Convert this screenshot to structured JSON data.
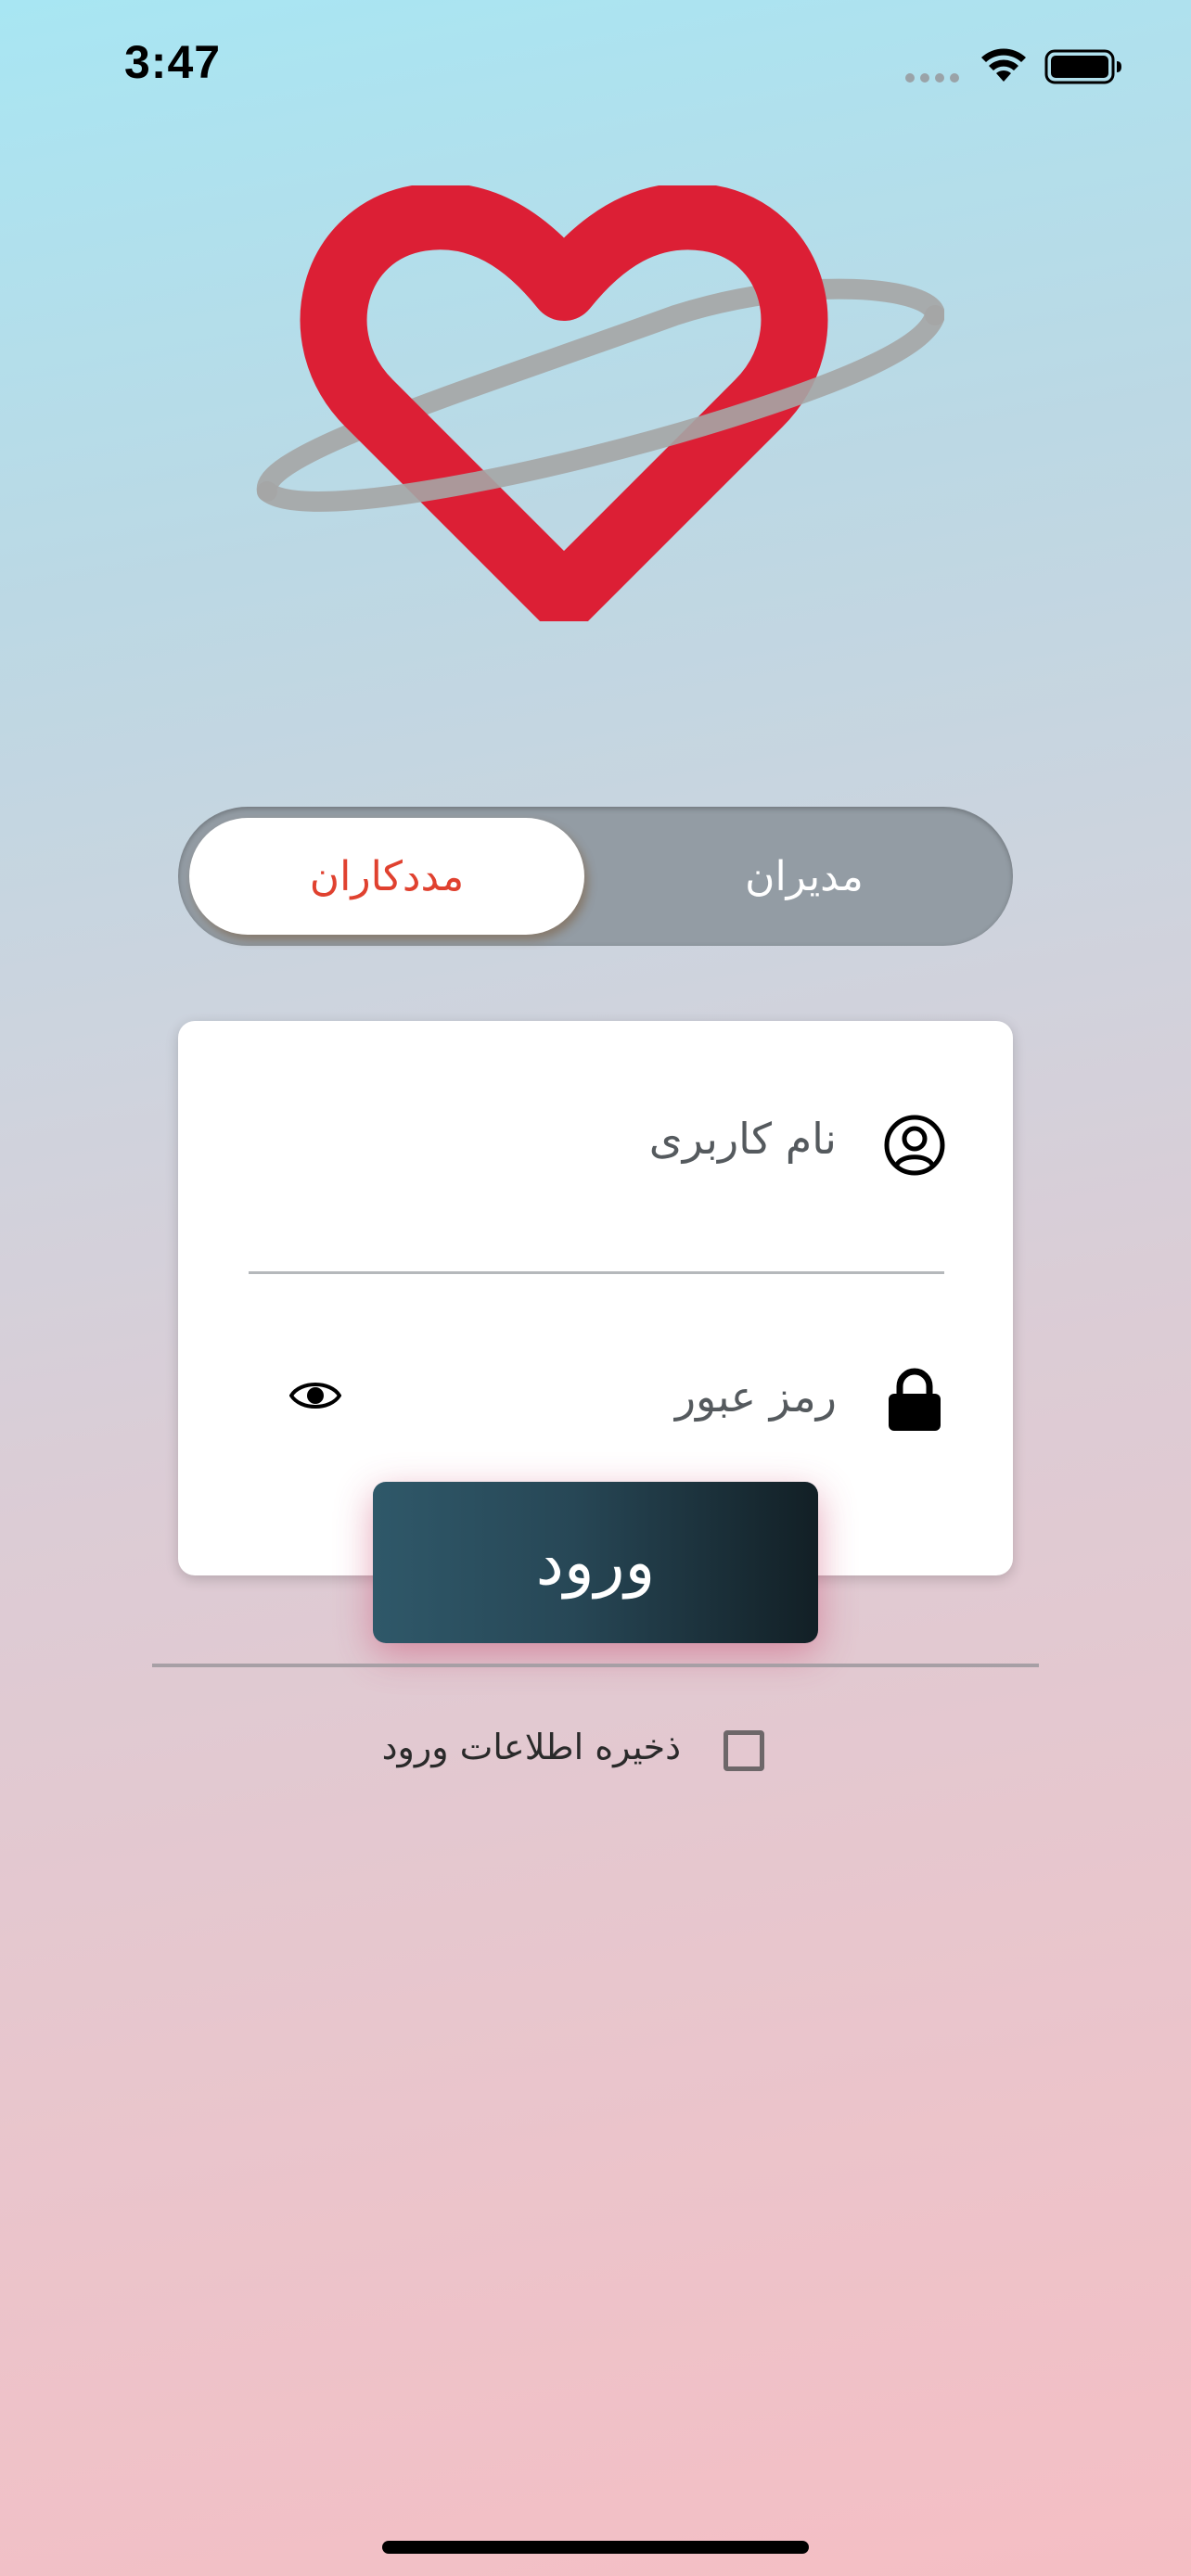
{
  "status_bar": {
    "time": "3:47"
  },
  "segmented_toggle": {
    "active_label": "مددکاران",
    "inactive_label": "مدیران"
  },
  "login_form": {
    "username_placeholder": "نام کاربری",
    "password_placeholder": "رمز عبور",
    "submit_label": "ورود"
  },
  "remember_me": {
    "label": "ذخیره اطلاعات ورود",
    "checked": false
  },
  "colors": {
    "brand_red": "#dc1f35",
    "active_tab_text": "#e0412f",
    "button_dark": "#274756"
  },
  "icons": {
    "user": "user-circle-icon",
    "lock": "lock-icon",
    "eye": "eye-icon",
    "checkbox": "checkbox-icon"
  }
}
